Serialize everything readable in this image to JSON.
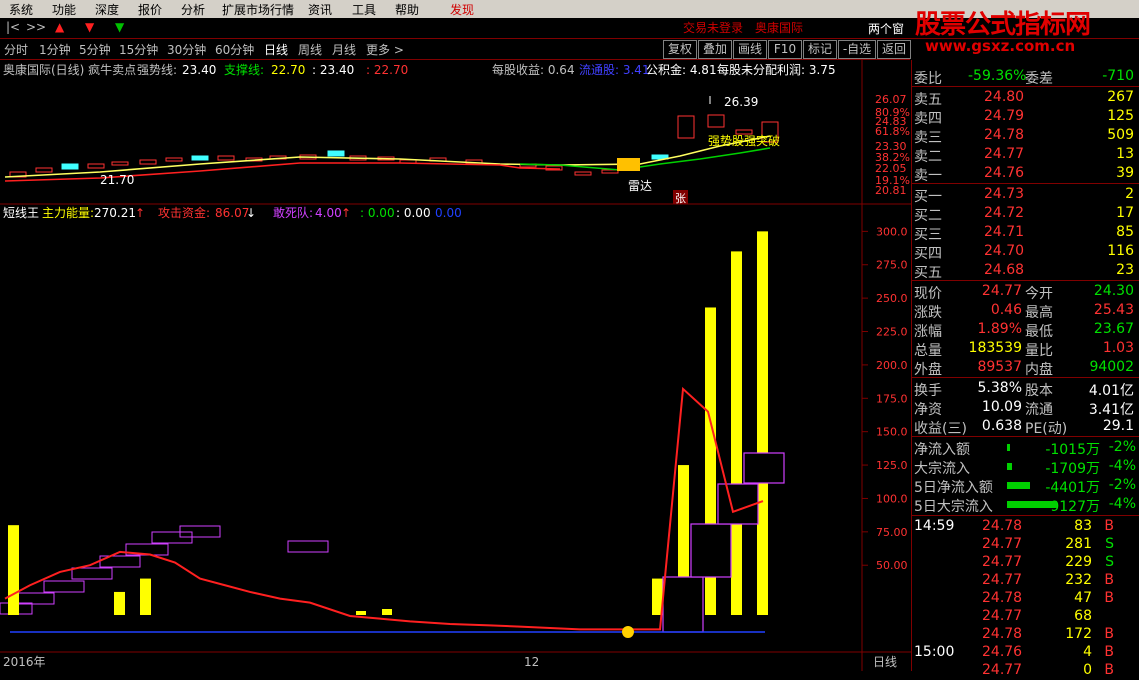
{
  "menu": [
    "系统",
    "功能",
    "深度",
    "报价",
    "分析",
    "扩展市场行情",
    "资讯",
    "工具",
    "帮助",
    "发现"
  ],
  "status_links": {
    "login": "交易未登录",
    "stock": "奥康国际"
  },
  "window_mode": "两个窗",
  "watermark": {
    "title": "股票公式指标网",
    "url": "www.gsxz.com.cn"
  },
  "periods": [
    "分时",
    "1分钟",
    "5分钟",
    "15分钟",
    "30分钟",
    "60分钟",
    "日线",
    "周线",
    "月线",
    "更多 >"
  ],
  "active_period": "日线",
  "tools": [
    "复权",
    "叠加",
    "画线",
    "F10",
    "标记",
    "-自选",
    "返回"
  ],
  "top_panel": {
    "title": "奥康国际(日线) 疯牛卖点",
    "strong_label": "强势线:",
    "strong_value": "23.40",
    "support_label": "支撑线:",
    "support_value": "22.70",
    "v3": ": 23.40",
    "v4": ": 22.70",
    "eps": "每股收益: 0.64",
    "float_label": "流通股: 3.41",
    "reserve": "公积金: 4.81",
    "undistributed": "每股未分配利润: 3.75",
    "price_axis": [
      "26.07",
      "80.9%",
      "24.83",
      "61.8%",
      "23.30",
      "38.2%",
      "22.05",
      "19.1%",
      "20.81"
    ],
    "annotations": {
      "high": "26.39",
      "low": "21.70",
      "radar": "雷达",
      "breakout": "强势股强突破",
      "zhang": "张"
    }
  },
  "bottom_panel": {
    "title": "短线王",
    "main_label": "主力能量:",
    "main_value": "270.21",
    "attack_label": "攻击资金:",
    "attack_value": "86.07",
    "dare_label": "敢死队:",
    "dare_value": "4.00",
    "v4": ": 0.00",
    "v5": ": 0.00",
    "v6": "0.00",
    "y_axis": [
      "300.0",
      "275.0",
      "250.0",
      "225.0",
      "200.0",
      "175.0",
      "150.0",
      "125.0",
      "100.0",
      "75.00",
      "50.00"
    ],
    "x_labels": {
      "start": "2016年",
      "mid": "12",
      "period": "日线"
    }
  },
  "chart_data": {
    "type": "bar",
    "title": "短线王",
    "series": [
      {
        "name": "主力能量",
        "values": [
          80,
          0,
          0,
          0,
          30,
          40,
          0,
          0,
          0,
          0,
          0,
          0,
          0,
          0,
          0,
          0,
          0,
          0,
          0,
          0,
          0,
          0,
          0,
          0,
          40,
          125,
          243,
          285,
          300
        ]
      },
      {
        "name": "攻击资金",
        "values": [
          25,
          35,
          45,
          50,
          60,
          58,
          52,
          40,
          35,
          30,
          25,
          22,
          12,
          10,
          8,
          6,
          5,
          4,
          3,
          2,
          2,
          2,
          2,
          2,
          2,
          182,
          165,
          90,
          98
        ]
      }
    ],
    "ylim": [
      0,
      310
    ]
  },
  "quote": {
    "weibi": {
      "label": "委比",
      "value": "-59.36%",
      "label2": "委差",
      "value2": "-710"
    },
    "asks": [
      {
        "label": "卖五",
        "price": "24.80",
        "vol": "267"
      },
      {
        "label": "卖四",
        "price": "24.79",
        "vol": "125"
      },
      {
        "label": "卖三",
        "price": "24.78",
        "vol": "509"
      },
      {
        "label": "卖二",
        "price": "24.77",
        "vol": "13"
      },
      {
        "label": "卖一",
        "price": "24.76",
        "vol": "39"
      }
    ],
    "bids": [
      {
        "label": "买一",
        "price": "24.73",
        "vol": "2"
      },
      {
        "label": "买二",
        "price": "24.72",
        "vol": "17"
      },
      {
        "label": "买三",
        "price": "24.71",
        "vol": "85"
      },
      {
        "label": "买四",
        "price": "24.70",
        "vol": "116"
      },
      {
        "label": "买五",
        "price": "24.68",
        "vol": "23"
      }
    ],
    "stats": [
      {
        "l1": "现价",
        "v1": "24.77",
        "l2": "今开",
        "v2": "24.30"
      },
      {
        "l1": "涨跌",
        "v1": "0.46",
        "l2": "最高",
        "v2": "25.43"
      },
      {
        "l1": "涨幅",
        "v1": "1.89%",
        "l2": "最低",
        "v2": "23.67"
      },
      {
        "l1": "总量",
        "v1": "183539",
        "l2": "量比",
        "v2": "1.03"
      },
      {
        "l1": "外盘",
        "v1": "89537",
        "l2": "内盘",
        "v2": "94002"
      }
    ],
    "fund": [
      {
        "l1": "换手",
        "v1": "5.38%",
        "l2": "股本",
        "v2": "4.01亿"
      },
      {
        "l1": "净资",
        "v1": "10.09",
        "l2": "流通",
        "v2": "3.41亿"
      },
      {
        "l1": "收益(三)",
        "v1": "0.638",
        "l2": "PE(动)",
        "v2": "29.1"
      }
    ],
    "flows": [
      {
        "label": "净流入额",
        "value": "-1015万",
        "pct": "-2%",
        "bar": 0.05
      },
      {
        "label": "大宗流入",
        "value": "-1709万",
        "pct": "-4%",
        "bar": 0.1
      },
      {
        "label": "5日净流入额",
        "value": "-4401万",
        "pct": "-2%",
        "bar": 0.45
      },
      {
        "label": "5日大宗流入",
        "value": "-9127万",
        "pct": "-4%",
        "bar": 1.0
      }
    ],
    "ticks": [
      {
        "time": "14:59",
        "price": "24.78",
        "vol": "83",
        "dir": "B"
      },
      {
        "time": "",
        "price": "24.77",
        "vol": "281",
        "dir": "S"
      },
      {
        "time": "",
        "price": "24.77",
        "vol": "229",
        "dir": "S"
      },
      {
        "time": "",
        "price": "24.77",
        "vol": "232",
        "dir": "B"
      },
      {
        "time": "",
        "price": "24.78",
        "vol": "47",
        "dir": "B"
      },
      {
        "time": "",
        "price": "24.77",
        "vol": "68",
        "dir": ""
      },
      {
        "time": "",
        "price": "24.78",
        "vol": "172",
        "dir": "B"
      },
      {
        "time": "15:00",
        "price": "24.76",
        "vol": "4",
        "dir": "B"
      },
      {
        "time": "",
        "price": "24.77",
        "vol": "0",
        "dir": "B"
      }
    ]
  }
}
